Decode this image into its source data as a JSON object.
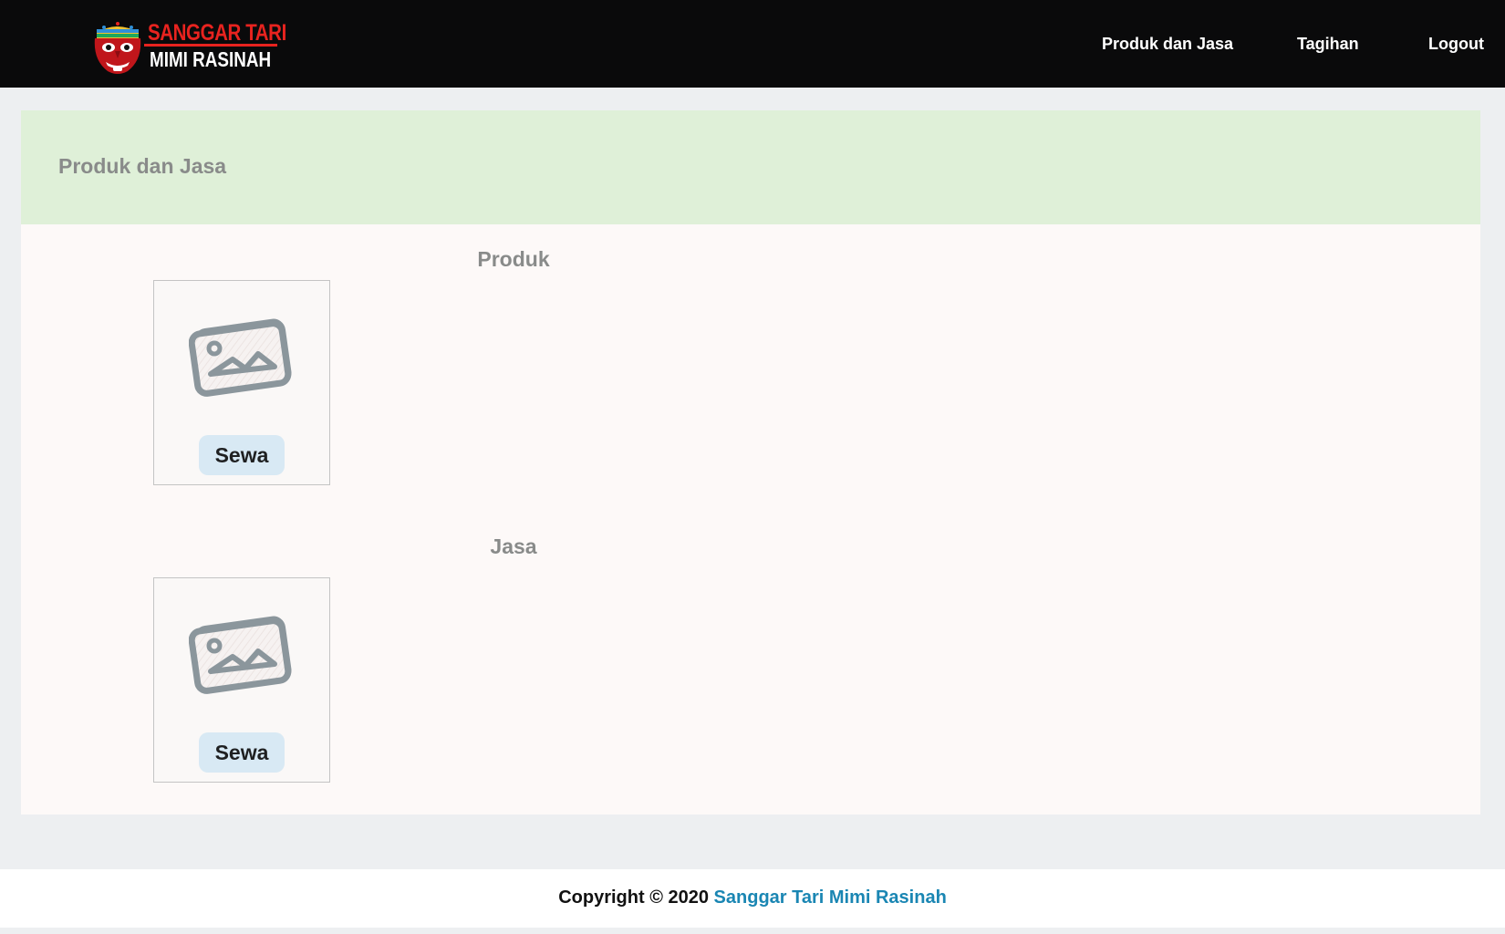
{
  "navbar": {
    "brand": {
      "title": "SANGGAR TARI",
      "subtitle": "MIMI RASINAH",
      "logo_icon": "mask-logo-icon"
    },
    "links": [
      {
        "label": "Produk dan Jasa"
      },
      {
        "label": "Tagihan"
      },
      {
        "label": "Logout"
      }
    ]
  },
  "card": {
    "title": "Produk dan Jasa",
    "sections": [
      {
        "title": "Produk",
        "items": [
          {
            "image_icon": "image-placeholder-icon",
            "button_label": "Sewa"
          }
        ]
      },
      {
        "title": "Jasa",
        "items": [
          {
            "image_icon": "image-placeholder-icon",
            "button_label": "Sewa"
          }
        ]
      }
    ]
  },
  "footer": {
    "prefix": "Copyright © 2020 ",
    "link_text": "Sanggar Tari Mimi Rasinah"
  },
  "colors": {
    "navbar_bg": "#0a0a0b",
    "header_bg": "#dff0d8",
    "button_bg": "#d8e9f4",
    "footer_link": "#1a86b3",
    "brand_red": "#e8231f"
  }
}
